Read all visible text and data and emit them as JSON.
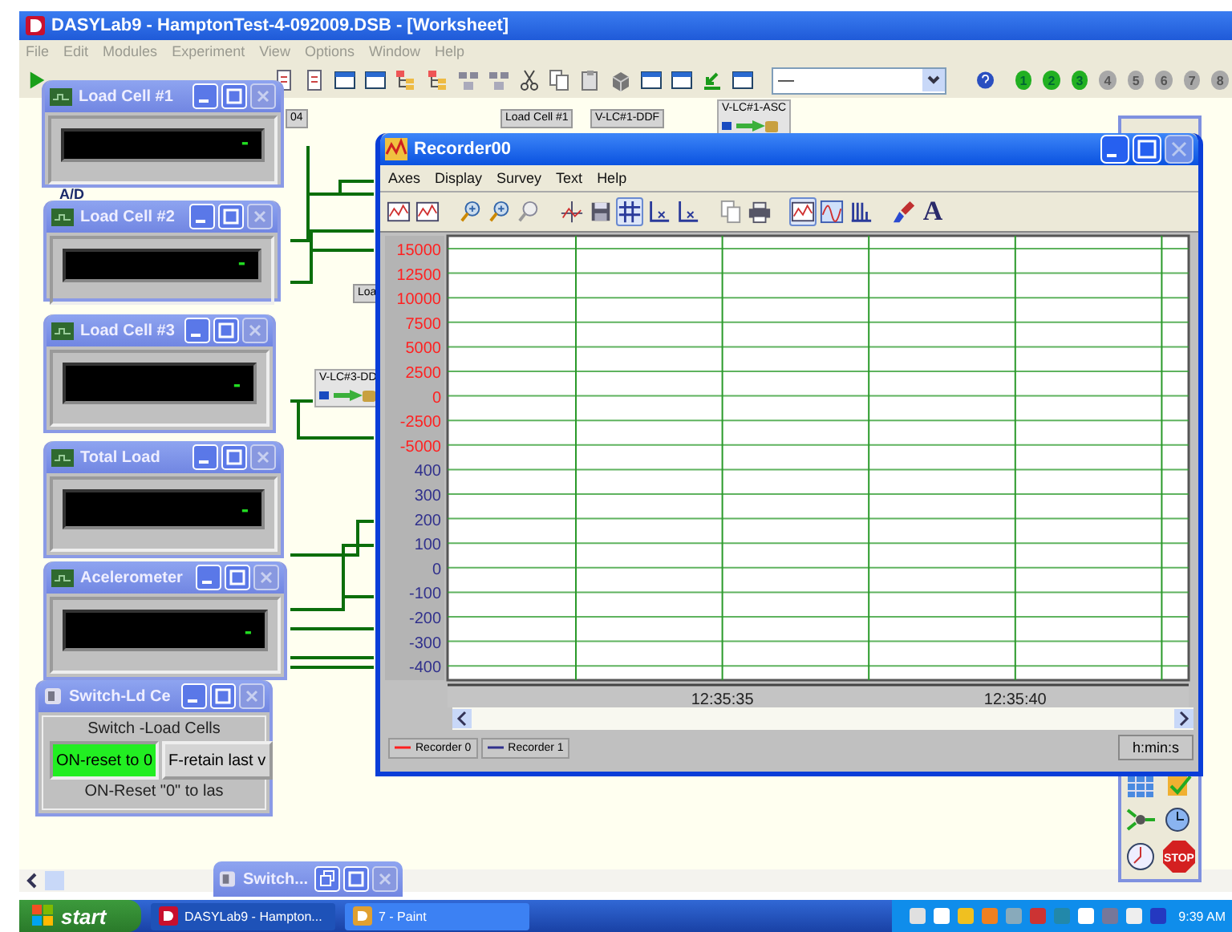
{
  "window": {
    "title": "DASYLab9 - HamptonTest-4-092009.DSB - [Worksheet]"
  },
  "menu": [
    {
      "label": "File",
      "disabled": true
    },
    {
      "label": "Edit",
      "disabled": true
    },
    {
      "label": "Modules",
      "disabled": true
    },
    {
      "label": "Experiment",
      "disabled": true
    },
    {
      "label": "View",
      "disabled": true
    },
    {
      "label": "Options",
      "disabled": true
    },
    {
      "label": "Window",
      "disabled": true
    },
    {
      "label": "Help",
      "disabled": true
    }
  ],
  "toolbar": {
    "dropdown": {
      "value": "—"
    },
    "steps": [
      {
        "label": "1",
        "active": true
      },
      {
        "label": "2",
        "active": true
      },
      {
        "label": "3",
        "active": true
      },
      {
        "label": "4",
        "active": false
      },
      {
        "label": "5",
        "active": false
      },
      {
        "label": "6",
        "active": false
      },
      {
        "label": "7",
        "active": false
      },
      {
        "label": "8",
        "active": false
      }
    ]
  },
  "worksheet": {
    "modules": [
      {
        "label": "04",
        "kind": "tag"
      },
      {
        "label": "A/D",
        "kind": "caption"
      },
      {
        "label": "Load Cell #1",
        "kind": "tag"
      },
      {
        "label": "V-LC#1-DDF",
        "kind": "tag"
      },
      {
        "label": "V-LC#1-ASC",
        "kind": "block"
      },
      {
        "label": "Loa",
        "kind": "tag"
      },
      {
        "label": "V-LC#3-DD",
        "kind": "block"
      }
    ]
  },
  "display_windows": [
    {
      "title": "Load Cell #1",
      "reading": "-"
    },
    {
      "title": "Load Cell #2",
      "reading": "-"
    },
    {
      "title": "Load Cell #3",
      "reading": "-"
    },
    {
      "title": "Total Load",
      "reading": "-"
    },
    {
      "title": "Acelerometer",
      "reading": "-"
    }
  ],
  "switch_window": {
    "title": "Switch-Ld Ce",
    "caption": "Switch -Load Cells",
    "buttons": [
      {
        "label": "ON-reset to 0",
        "selected": true
      },
      {
        "label": "F-retain last v",
        "selected": false
      }
    ],
    "status": "ON-Reset \"0\" to las"
  },
  "recorder": {
    "title": "Recorder00",
    "menu": [
      "Axes",
      "Display",
      "Survey",
      "Text",
      "Help"
    ],
    "toolbar": [
      [
        {
          "kind": "icon",
          "pressed": false
        },
        {
          "kind": "icon",
          "pressed": false
        }
      ],
      [
        {
          "kind": "icon",
          "pressed": false
        },
        {
          "kind": "icon",
          "pressed": false
        },
        {
          "kind": "icon",
          "pressed": false
        }
      ],
      [
        {
          "kind": "icon",
          "pressed": false
        },
        {
          "kind": "icon",
          "pressed": false
        },
        {
          "kind": "icon",
          "pressed": true
        },
        {
          "kind": "icon",
          "pressed": false
        },
        {
          "kind": "icon",
          "pressed": false
        }
      ],
      [
        {
          "kind": "icon",
          "pressed": false
        },
        {
          "kind": "icon",
          "pressed": false
        }
      ],
      [
        {
          "kind": "icon",
          "pressed": true
        },
        {
          "kind": "icon",
          "pressed": false
        },
        {
          "kind": "icon",
          "pressed": false
        }
      ],
      [
        {
          "kind": "icon",
          "pressed": false
        },
        {
          "kind": "text",
          "text": "A",
          "pressed": false
        }
      ]
    ],
    "plot": {
      "y_labels": [
        {
          "text": "15000",
          "color": "#ff2020"
        },
        {
          "text": "12500",
          "color": "#ff2020"
        },
        {
          "text": "10000",
          "color": "#ff2020"
        },
        {
          "text": "7500",
          "color": "#ff2020"
        },
        {
          "text": "5000",
          "color": "#ff2020"
        },
        {
          "text": "2500",
          "color": "#ff2020"
        },
        {
          "text": "0",
          "color": "#ff2020"
        },
        {
          "text": "-2500",
          "color": "#ff2020"
        },
        {
          "text": "-5000",
          "color": "#ff2020"
        },
        {
          "text": "400",
          "color": "#30308c"
        },
        {
          "text": "300",
          "color": "#30308c"
        },
        {
          "text": "200",
          "color": "#30308c"
        },
        {
          "text": "100",
          "color": "#30308c"
        },
        {
          "text": "0",
          "color": "#30308c"
        },
        {
          "text": "-100",
          "color": "#30308c"
        },
        {
          "text": "-200",
          "color": "#30308c"
        },
        {
          "text": "-300",
          "color": "#30308c"
        },
        {
          "text": "-400",
          "color": "#30308c"
        }
      ],
      "time_labels": [
        "12:35:35",
        "12:35:40"
      ],
      "legend": [
        {
          "name": "Recorder 0",
          "color": "#ff2020"
        },
        {
          "name": "Recorder 1",
          "color": "#30308c"
        }
      ],
      "unit": "h:min:s"
    }
  },
  "minimized_window": {
    "title": "Switch..."
  },
  "palette": {
    "stop_label": "STOP"
  },
  "taskbar": {
    "start": "start",
    "tasks": [
      {
        "label": "DASYLab9 - Hampton...",
        "selected": true
      },
      {
        "label": "7 - Paint",
        "selected": false
      }
    ],
    "clock": "9:39 AM"
  }
}
